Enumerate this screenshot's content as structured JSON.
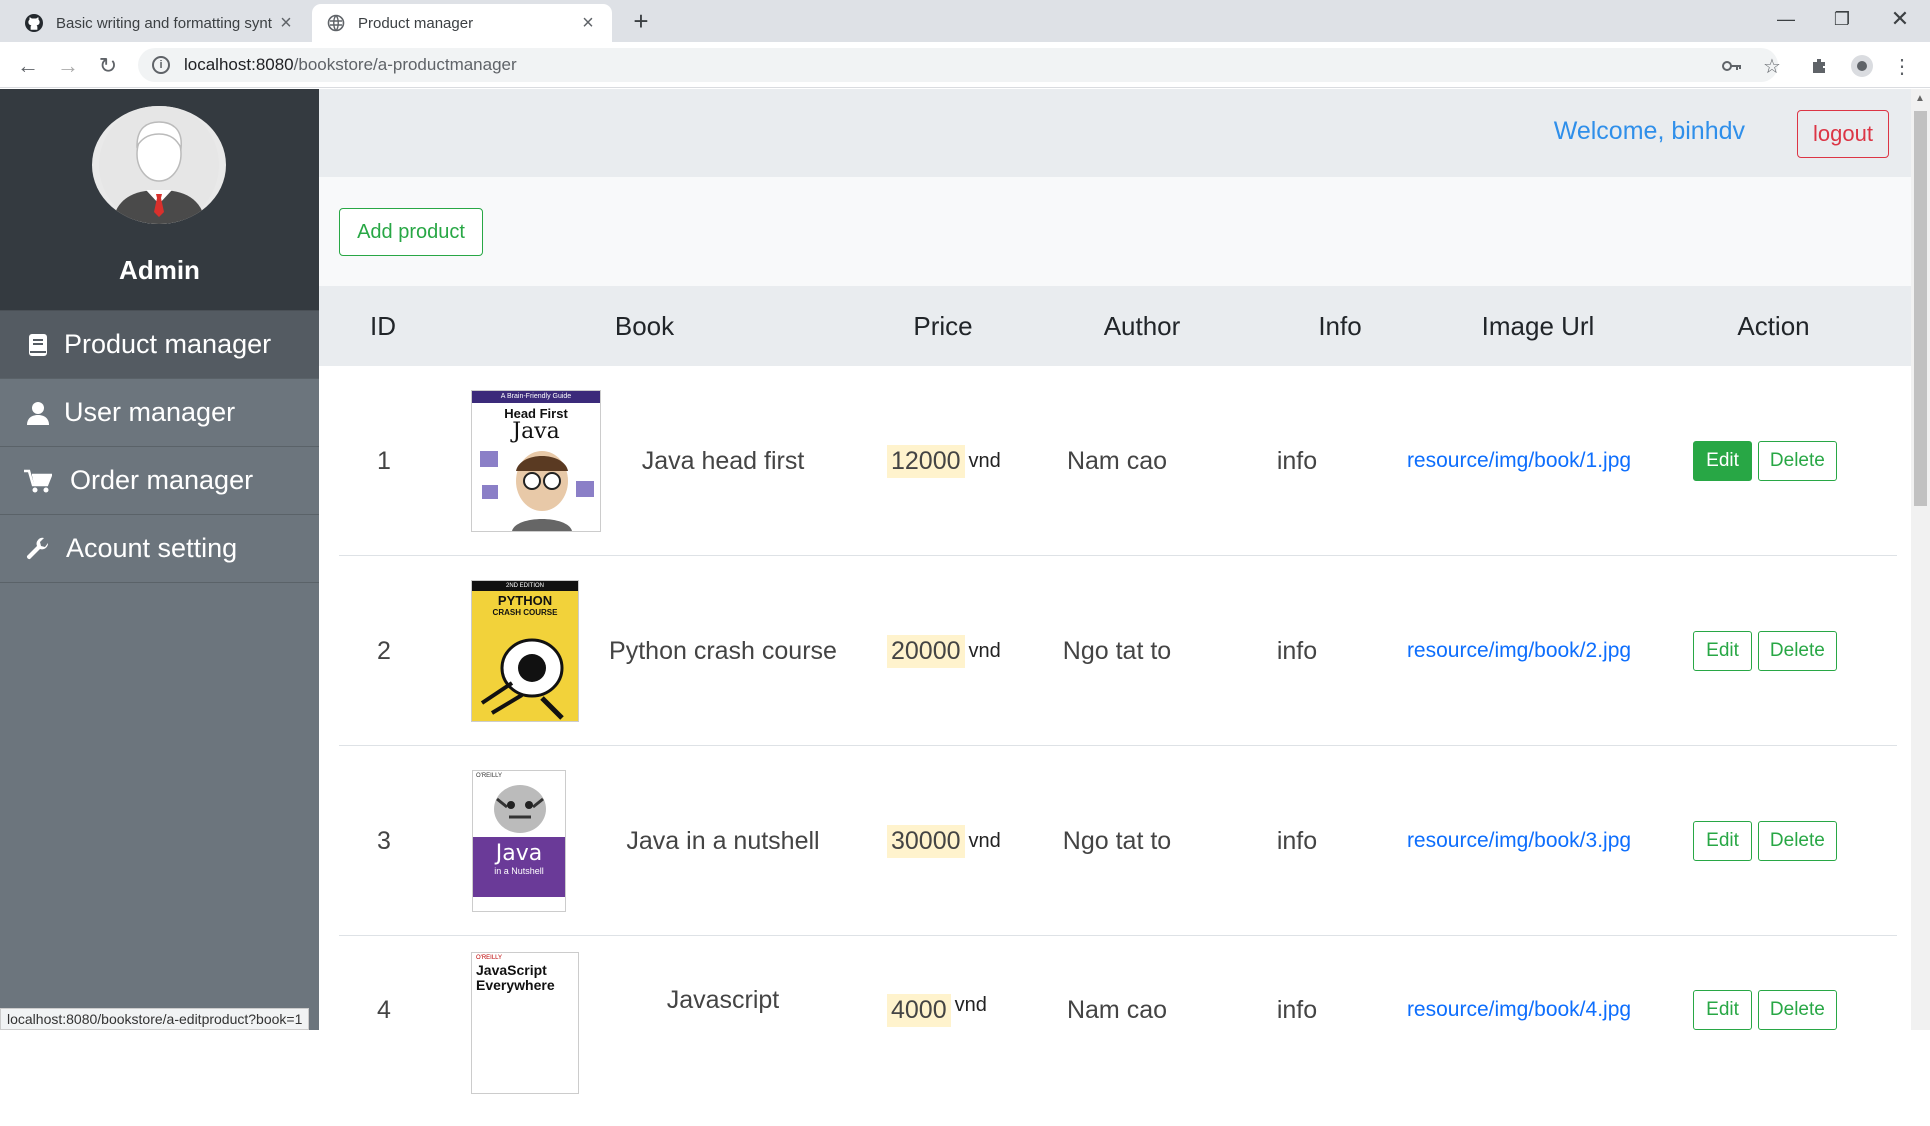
{
  "browser": {
    "tabs": [
      {
        "title": "Basic writing and formatting synt",
        "icon": "github-icon"
      },
      {
        "title": "Product manager",
        "icon": "globe-icon"
      }
    ],
    "url_host": "localhost:8080",
    "url_path": "/bookstore/a-productmanager",
    "status_url": "localhost:8080/bookstore/a-editproduct?book=1"
  },
  "sidebar": {
    "title": "Admin",
    "items": [
      {
        "label": "Product manager",
        "icon": "book-icon"
      },
      {
        "label": "User manager",
        "icon": "user-icon"
      },
      {
        "label": "Order manager",
        "icon": "cart-icon"
      },
      {
        "label": "Acount setting",
        "icon": "wrench-icon"
      }
    ]
  },
  "header": {
    "welcome": "Welcome, binhdv",
    "logout": "logout"
  },
  "main": {
    "add_product": "Add product",
    "columns": [
      "ID",
      "Book",
      "Price",
      "Author",
      "Info",
      "Image Url",
      "Action"
    ],
    "rows": [
      {
        "id": "1",
        "name": "Java head first",
        "price": "12000",
        "unit": "vnd",
        "author": "Nam cao",
        "info": "info",
        "url": "resource/img/book/1.jpg",
        "edit": "Edit",
        "delete": "Delete"
      },
      {
        "id": "2",
        "name": "Python crash course",
        "price": "20000",
        "unit": "vnd",
        "author": "Ngo tat to",
        "info": "info",
        "url": "resource/img/book/2.jpg",
        "edit": "Edit",
        "delete": "Delete"
      },
      {
        "id": "3",
        "name": "Java in a nutshell",
        "price": "30000",
        "unit": "vnd",
        "author": "Ngo tat to",
        "info": "info",
        "url": "resource/img/book/3.jpg",
        "edit": "Edit",
        "delete": "Delete"
      },
      {
        "id": "4",
        "name": "Javascript",
        "price": "4000",
        "unit": "vnd",
        "author": "Nam cao",
        "info": "info",
        "url": "resource/img/book/4.jpg",
        "edit": "Edit",
        "delete": "Delete"
      }
    ],
    "covers": [
      {
        "line1": "A Brain-Friendly Guide",
        "line2": "Head First",
        "line3": "Java"
      },
      {
        "line1": "2ND EDITION",
        "line2": "PYTHON",
        "line3": "CRASH COURSE"
      },
      {
        "line1": "O'REILLY",
        "line2": "Java",
        "line3": "in a Nutshell"
      },
      {
        "line1": "O'REILLY",
        "line2": "JavaScript",
        "line3": "Everywhere"
      }
    ]
  }
}
